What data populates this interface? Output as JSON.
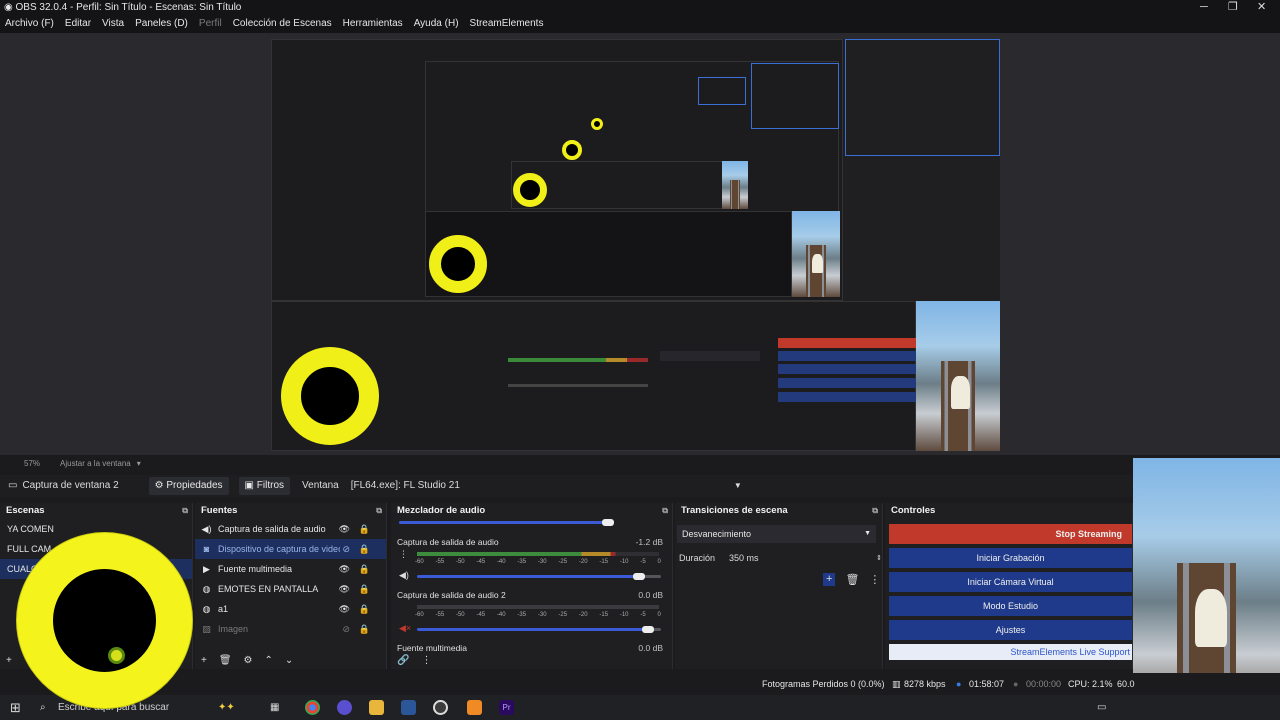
{
  "window": {
    "title": "OBS 32.0.4 - Perfil: Sin Título - Escenas: Sin Título",
    "minimize": "─",
    "maximize": "❐",
    "close": "✕"
  },
  "menu": [
    "Archivo (F)",
    "Editar",
    "Vista",
    "Paneles (D)",
    "Perfil",
    "Colección de Escenas",
    "Herramientas",
    "Ayuda (H)",
    "StreamElements"
  ],
  "preview_bar": {
    "zoom": "57%",
    "fit_label": "Ajustar a la ventana"
  },
  "source_toolbar": {
    "current_source": "Captura de ventana 2",
    "properties_label": "Propiedades",
    "filters_label": "Filtros",
    "window_label": "Ventana",
    "window_value": "[FL64.exe]: FL Studio 21"
  },
  "scenes": {
    "title": "Escenas",
    "items": [
      "YA COMEN",
      "FULL CAM",
      "CUALQ"
    ],
    "selected_index": 2
  },
  "sources": {
    "title": "Fuentes",
    "items": [
      {
        "label": "Captura de salida de audio",
        "icon": "speaker-icon"
      },
      {
        "label": "Dispositivo de captura de video",
        "icon": "camera-icon"
      },
      {
        "label": "Fuente multimedia",
        "icon": "play-icon"
      },
      {
        "label": "EMOTES EN PANTALLA",
        "icon": "globe-icon"
      },
      {
        "label": "a1",
        "icon": "globe-icon"
      },
      {
        "label": "Imagen",
        "icon": "image-icon"
      }
    ],
    "selected_index": 1
  },
  "mixer": {
    "title": "Mezclador de audio",
    "channels": [
      {
        "name": "Captura de salida de audio",
        "db": "-1.2 dB",
        "level": 0.82,
        "volume": 0.93
      },
      {
        "name": "Captura de salida de audio 2",
        "db": "0.0 dB",
        "level": 0.0,
        "volume": 0.97
      },
      {
        "name": "Fuente multimedia",
        "db": "0.0 dB",
        "level": 0.0,
        "volume": 1.0
      }
    ],
    "ticks": [
      "-60",
      "-55",
      "-50",
      "-45",
      "-40",
      "-35",
      "-30",
      "-25",
      "-20",
      "-15",
      "-10",
      "-5",
      "0"
    ]
  },
  "transitions": {
    "title": "Transiciones de escena",
    "type": "Desvanecimiento",
    "duration_label": "Duración",
    "duration_value": "350 ms"
  },
  "controls": {
    "title": "Controles",
    "stop_streaming": "Stop Streaming",
    "start_recording": "Iniciar Grabación",
    "virtual_camera": "Iniciar Cámara Virtual",
    "studio_mode": "Modo Estudio",
    "settings": "Ajustes",
    "streamelements": "StreamElements Live Support"
  },
  "status": {
    "dropped_frames": "Fotogramas Perdidos 0 (0.0%)",
    "bitrate": "8278 kbps",
    "stream_time": "01:58:07",
    "record_time": "00:00:00",
    "cpu": "CPU: 2.1%",
    "fps": "60.0"
  },
  "taskbar": {
    "search_placeholder": "Escribe aquí para buscar"
  },
  "colors": {
    "accent_blue": "#1f3a8a",
    "stop_red": "#c0392b",
    "selection": "#1d2f5e",
    "overlay_yellow": "#f4f41c"
  }
}
